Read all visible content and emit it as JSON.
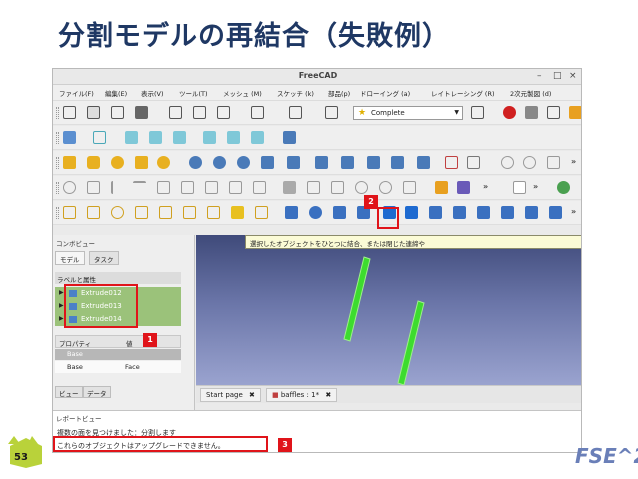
{
  "slide": {
    "title": "分割モデルの再結合（失敗例）",
    "page_number": "53",
    "logo_text": "FSE^2"
  },
  "window": {
    "title": "FreeCAD",
    "controls": [
      "–",
      "□",
      "×"
    ]
  },
  "menubar": {
    "items": [
      "ファイル(F)",
      "編集(E)",
      "表示(V)",
      "ツール(T)",
      "メッシュ (M)",
      "スケッチ (k)",
      "部品(p)",
      "ドローイング (a)",
      "レイトレーシング (R)",
      "2次元製図 (d)"
    ]
  },
  "toolbar": {
    "workbench_selector": "Complete",
    "more": "»"
  },
  "combo_view": {
    "title": "コンボビュー",
    "tabs": [
      "モデル",
      "タスク"
    ],
    "tree_header": "ラベルと属性",
    "tree_items": [
      "Extrude012",
      "Extrude013",
      "Extrude014"
    ],
    "property_headers": [
      "プロパティ",
      "値"
    ],
    "property_group": "Base",
    "property_rows": [
      {
        "name": "Base",
        "value": "Face"
      }
    ],
    "bottom_tabs": [
      "ビュー",
      "データ"
    ]
  },
  "viewport": {
    "tooltip": "選択したオブジェクトをひとつに結合、または閉じた連締や",
    "doc_tabs": [
      "Start page",
      "baffles : 1*"
    ]
  },
  "report_view": {
    "title": "レポートビュー",
    "lines": [
      "複数の面を見つけました：分割します",
      "これらのオブジェクトはアップグレードできません。"
    ]
  },
  "annotations": {
    "badge1": "1",
    "badge2": "2",
    "badge3": "3"
  },
  "colors": {
    "title": "#1f3864",
    "annotation": "#e0141a",
    "tree_selected": "#9bc27a",
    "model_green": "#3ddc2e"
  }
}
